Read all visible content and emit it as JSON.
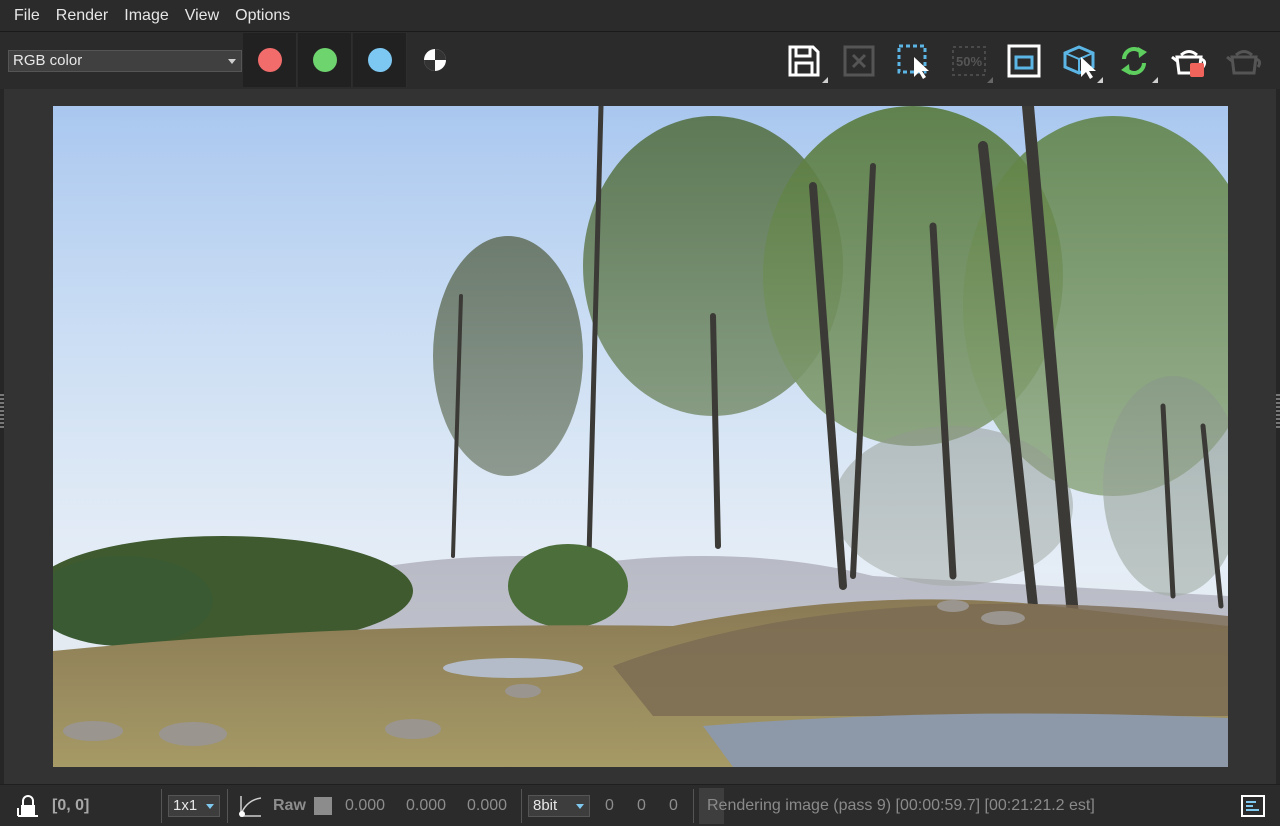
{
  "menu": [
    "File",
    "Render",
    "Image",
    "View",
    "Options"
  ],
  "toolbar": {
    "channel_select": "RGB color",
    "channels": [
      {
        "name": "red-channel",
        "color": "#f26c6c"
      },
      {
        "name": "green-channel",
        "color": "#6ed46e"
      },
      {
        "name": "blue-channel",
        "color": "#7cc8f2"
      }
    ],
    "zoom_label": "50%"
  },
  "statusbar": {
    "coords": "[0, 0]",
    "sample_size": "1x1",
    "mode_label": "Raw",
    "float_values": [
      "0.000",
      "0.000",
      "0.000"
    ],
    "bit_depth": "8bit",
    "int_values": [
      "0",
      "0",
      "0"
    ],
    "progress": 0.06,
    "status_text": "Rendering image (pass 9) [00:00:59.7] [00:21:21.2 est]"
  },
  "colors": {
    "accent_blue": "#5bb6e6",
    "accent_green": "#5ecf5e",
    "accent_red": "#f0645c"
  }
}
